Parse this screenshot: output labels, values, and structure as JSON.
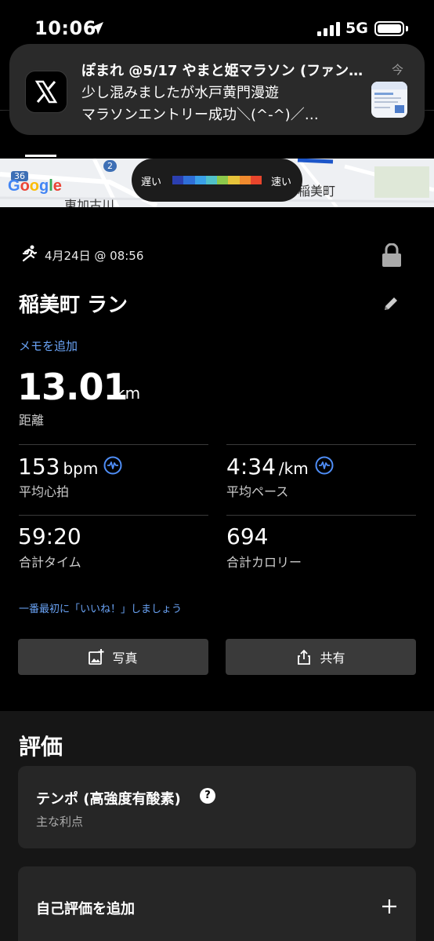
{
  "status_bar": {
    "time": "10:06",
    "network": "5G"
  },
  "notification": {
    "app": "X",
    "title": "ぽまれ @5/17 やまと姫マラソン (ファン…",
    "body_line1": "少し混みましたが水戸黄門漫遊",
    "body_line2": "マラソンエントリー成功＼(^-^)／…",
    "time": "今"
  },
  "map": {
    "logo": "Google",
    "labels": [
      "36",
      "2",
      "東加古川",
      "稲美町"
    ],
    "legend": {
      "slow": "遅い",
      "fast": "速い"
    },
    "legend_colors": [
      "#2b3fb0",
      "#2f6fd8",
      "#3aa0e8",
      "#50c0c8",
      "#8cc84b",
      "#e6c33a",
      "#f08a2e",
      "#e8452c"
    ]
  },
  "activity": {
    "type_icon": "run-icon",
    "datetime": "4月24日 @ 08:56",
    "title": "稲美町 ラン",
    "add_memo": "メモを追加",
    "distance": {
      "value": "13.01",
      "unit": "km",
      "label": "距離"
    },
    "stats": {
      "heart_rate": {
        "value": "153",
        "unit": "bpm",
        "label": "平均心拍"
      },
      "pace": {
        "value": "4:34",
        "unit": "/km",
        "label": "平均ペース"
      },
      "time": {
        "value": "59:20",
        "label": "合計タイム"
      },
      "calories": {
        "value": "694",
        "label": "合計カロリー"
      }
    },
    "like_prompt": "一番最初に「いいね！」しましょう",
    "buttons": {
      "photo": "写真",
      "share": "共有"
    }
  },
  "rating": {
    "heading": "評価",
    "card_title": "テンポ (高強度有酸素)",
    "card_subtitle": "主な利点",
    "self_rating": "自己評価を追加"
  },
  "colors": {
    "link": "#6aa3f5",
    "accent_wave": "#4f8ef7"
  }
}
